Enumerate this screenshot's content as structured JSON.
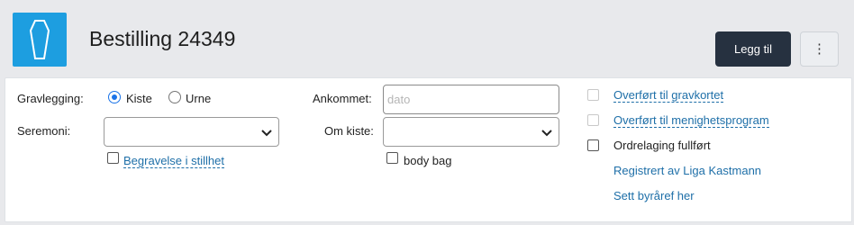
{
  "header": {
    "title": "Bestilling 24349",
    "add_label": "Legg til",
    "more_label": "⋮",
    "icon": "coffin-icon",
    "icon_color": "#1d9ee0"
  },
  "form": {
    "burial": {
      "label": "Gravlegging:",
      "options": [
        "Kiste",
        "Urne"
      ],
      "selected": "Kiste"
    },
    "ceremony": {
      "label": "Seremoni:",
      "value": ""
    },
    "silent_burial": {
      "label": "Begravelse i stillhet",
      "checked": false
    },
    "arrived": {
      "label": "Ankommet:",
      "placeholder": "dato",
      "value": ""
    },
    "about_coffin": {
      "label": "Om kiste:",
      "value": ""
    },
    "body_bag": {
      "label": "body bag",
      "checked": false
    }
  },
  "status": {
    "grave_card": {
      "label": "Overført til gravkortet",
      "checked": false,
      "disabled": true
    },
    "church_program": {
      "label": "Overført til menighetsprogram",
      "checked": false,
      "disabled": true
    },
    "order_done": {
      "label": "Ordrelaging fullført",
      "checked": false
    },
    "registered_by": "Registrert av Liga Kastmann",
    "set_agency": "Sett byråref her"
  },
  "colors": {
    "accent": "#1a73e8",
    "link": "#1e6fa8",
    "button_dark": "#263140"
  }
}
